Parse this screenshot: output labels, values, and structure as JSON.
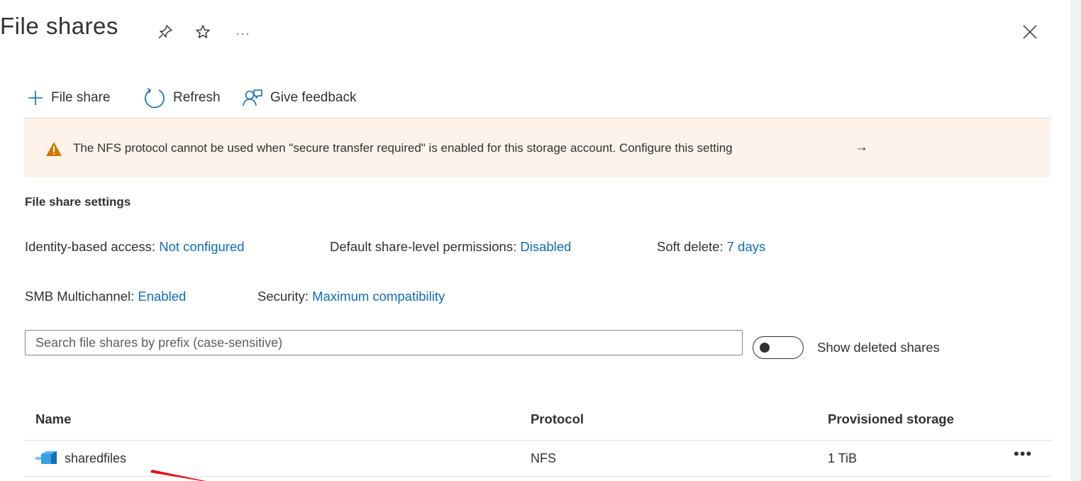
{
  "page": {
    "title": "File shares"
  },
  "header_icons": [
    "pin-icon",
    "star-icon",
    "more-icon",
    "close-icon"
  ],
  "toolbar": {
    "add_label": "File share",
    "refresh_label": "Refresh",
    "feedback_label": "Give feedback"
  },
  "banner": {
    "text": "The NFS protocol cannot be used when \"secure transfer required\" is enabled for this storage account. Configure this setting",
    "arrow": "→",
    "color": "#fdf3ea",
    "warning_color": "#d47500"
  },
  "settings": {
    "title": "File share settings",
    "identity_label": "Identity-based access:",
    "identity_value": "Not configured",
    "default_perm_label": "Default share-level permissions:",
    "default_perm_value": "Disabled",
    "soft_delete_label": "Soft delete:",
    "soft_delete_value": "7 days",
    "smb_label": "SMB Multichannel:",
    "smb_value": "Enabled",
    "security_label": "Security:",
    "security_value": "Maximum compatibility",
    "link_color": "#0f6cbd"
  },
  "search": {
    "placeholder": "Search file shares by prefix (case-sensitive)",
    "value": ""
  },
  "toggle": {
    "label": "Show deleted shares",
    "on": false
  },
  "table": {
    "columns": [
      "Name",
      "Protocol",
      "Provisioned storage"
    ],
    "rows": [
      {
        "name": "sharedfiles",
        "protocol": "NFS",
        "storage": "1 TiB",
        "more": "•••"
      }
    ]
  }
}
